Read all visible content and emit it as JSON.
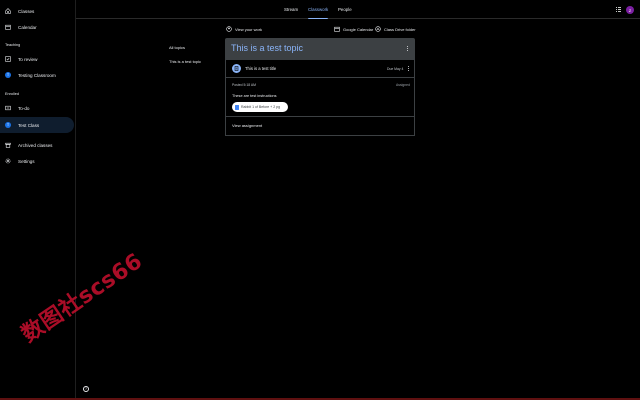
{
  "sidebar": {
    "items": [
      {
        "label": "Classes",
        "icon": "home-icon"
      },
      {
        "label": "Calendar",
        "icon": "calendar-icon"
      }
    ],
    "teaching_label": "Teaching",
    "teaching_items": [
      {
        "label": "To review",
        "icon": "review-icon"
      },
      {
        "label": "Testing Classroom",
        "icon": "class-avatar",
        "initial": "T"
      }
    ],
    "enrolled_label": "Enrolled",
    "enrolled_items": [
      {
        "label": "To-do",
        "icon": "todo-icon"
      },
      {
        "label": "Test Class",
        "icon": "class-avatar",
        "initial": "T",
        "active": true
      }
    ],
    "bottom_items": [
      {
        "label": "Archived classes",
        "icon": "archive-icon"
      },
      {
        "label": "Settings",
        "icon": "gear-icon"
      }
    ]
  },
  "topbar": {
    "tabs": [
      "Stream",
      "Classwork",
      "People"
    ],
    "active_tab": "Classwork",
    "user_initial": "Z"
  },
  "filters": {
    "all_topics": "All topics",
    "topic": "This is a test topic"
  },
  "actions": {
    "view_work": "View your work",
    "google_calendar": "Google Calendar",
    "drive_folder": "Class Drive folder"
  },
  "topic": {
    "title": "This is a test topic",
    "assignment": {
      "title": "This is a test title",
      "due": "Due May 4",
      "posted": "Posted 5:18 AM",
      "status": "Assigned",
      "instructions": "These are test instructions",
      "attachment": "Rabbit 1 of Before + 2 pg",
      "view_link": "View assignment"
    }
  },
  "help_label": "?",
  "watermark": "数图社scs66",
  "colors": {
    "accent": "#8ab4f8",
    "class_avatar": "#1a73e8",
    "user_avatar": "#7b1fa2",
    "topic_header": "#3c4043"
  }
}
